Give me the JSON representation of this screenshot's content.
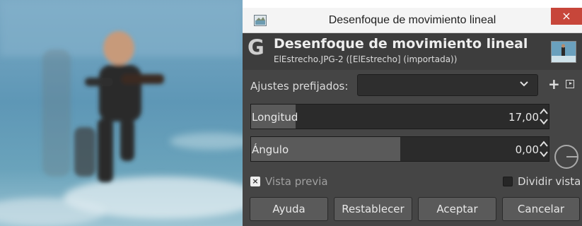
{
  "window": {
    "title": "Desenfoque de movimiento lineal",
    "close_glyph": "×",
    "icon": "gimp-window-icon"
  },
  "header": {
    "logo_glyph": "G",
    "title": "Desenfoque de movimiento lineal",
    "subtitle": "ElEstrecho.JPG-2 ([ElEstrecho] (importada))"
  },
  "presets": {
    "label": "Ajustes prefijados:",
    "value": "",
    "add_glyph": "+"
  },
  "fields": {
    "length": {
      "label": "Longitud",
      "value": "17,00",
      "fill_fraction": 0.15
    },
    "angle": {
      "label": "Ángulo",
      "value": "0,00",
      "fill_fraction": 0.5
    }
  },
  "options": {
    "preview": {
      "label": "Vista previa",
      "checked": true,
      "check_glyph": "×"
    },
    "split_view": {
      "label": "Dividir vista",
      "checked": false
    }
  },
  "buttons": {
    "help": "Ayuda",
    "reset": "Restablecer",
    "ok": "Aceptar",
    "cancel": "Cancelar"
  },
  "colors": {
    "dialog_bg": "#454545",
    "close_button": "#c7463a",
    "field_fill": "#5a5a5a"
  }
}
